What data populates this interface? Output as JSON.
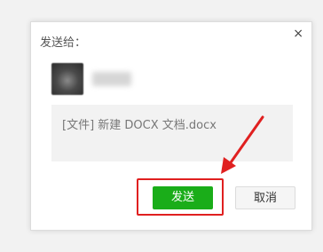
{
  "dialog": {
    "title": "发送给：",
    "close_glyph": "×",
    "message_text": "[文件] 新建 DOCX 文档.docx",
    "send_label": "发送",
    "cancel_label": "取消"
  },
  "colors": {
    "send_button": "#1aad19",
    "annotation_red": "#e02020"
  }
}
